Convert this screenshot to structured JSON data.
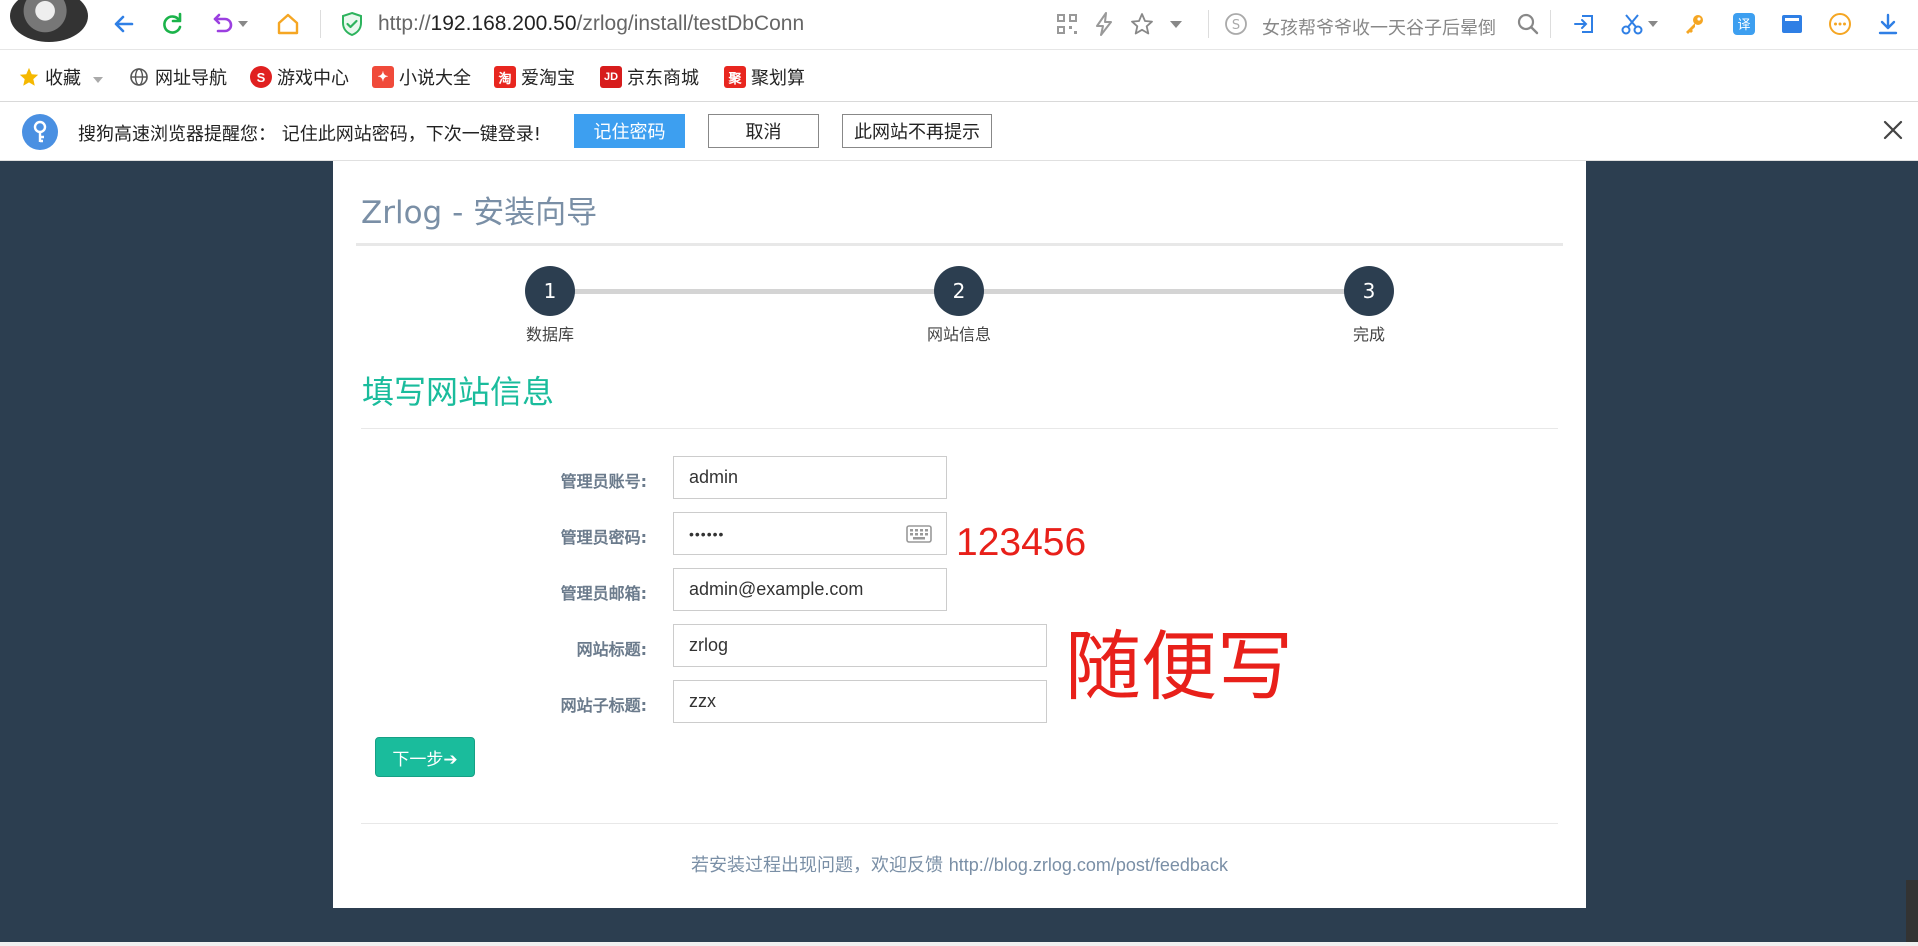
{
  "browser": {
    "url_prefix": "http://",
    "url_host": "192.168.200.50",
    "url_path": "/zrlog/install/testDbConn",
    "search_text": "女孩帮爷爷收一天谷子后晕倒"
  },
  "bookmarks": [
    {
      "label": "收藏",
      "icon": "star-icon",
      "color": "#f5b800"
    },
    {
      "label": "网址导航",
      "icon": "globe-icon",
      "color": "#555555"
    },
    {
      "label": "游戏中心",
      "icon": "sogou-game-icon",
      "color": "#e02020"
    },
    {
      "label": "小说大全",
      "icon": "novel-icon",
      "color": "#f04a3a"
    },
    {
      "label": "爱淘宝",
      "icon": "taobao-icon",
      "color": "#e8261f"
    },
    {
      "label": "京东商城",
      "icon": "jd-icon",
      "color": "#d71c1c"
    },
    {
      "label": "聚划算",
      "icon": "juhuasuan-icon",
      "color": "#e8261f"
    }
  ],
  "notice": {
    "message": "搜狗高速浏览器提醒您：  记住此网站密码，下次一键登录!",
    "remember_label": "记住密码",
    "cancel_label": "取消",
    "never_label": "此网站不再提示"
  },
  "wizard": {
    "title": "Zrlog - 安装向导",
    "steps": [
      {
        "number": "1",
        "label": "数据库"
      },
      {
        "number": "2",
        "label": "网站信息"
      },
      {
        "number": "3",
        "label": "完成"
      }
    ],
    "section_heading": "填写网站信息",
    "fields": {
      "admin_account": {
        "label": "管理员账号:",
        "value": "admin"
      },
      "admin_password": {
        "label": "管理员密码:",
        "value": "••••••"
      },
      "admin_email": {
        "label": "管理员邮箱:",
        "value": "admin@example.com"
      },
      "site_title": {
        "label": "网站标题:",
        "value": "zrlog"
      },
      "site_subtitle": {
        "label": "网站子标题:",
        "value": "zzx"
      }
    },
    "next_label": "下一步➔",
    "footer_text": "若安装过程出现问题，欢迎反馈 ",
    "footer_link": "http://blog.zrlog.com/post/feedback"
  },
  "annotations": {
    "password_note": "123456",
    "title_note": "随便写"
  },
  "colors": {
    "page_background": "#2c3e50",
    "accent_green": "#1abc9c",
    "annotation_red": "#e8201a",
    "step_circle": "#2c3e50"
  }
}
